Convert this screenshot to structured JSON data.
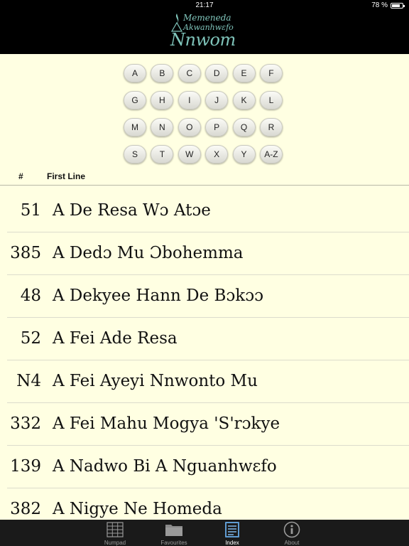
{
  "status": {
    "time": "21:17",
    "battery": "78 %"
  },
  "logo": {
    "line1": "Memeneda",
    "line2": "Akwanhwɛfo",
    "line3": "Nnwom"
  },
  "letters": [
    [
      "A",
      "B",
      "C",
      "D",
      "E",
      "F"
    ],
    [
      "G",
      "H",
      "I",
      "J",
      "K",
      "L"
    ],
    [
      "M",
      "N",
      "O",
      "P",
      "Q",
      "R"
    ],
    [
      "S",
      "T",
      "W",
      "X",
      "Y",
      "A-Z"
    ]
  ],
  "columns": {
    "number": "#",
    "first_line": "First Line"
  },
  "hymns": [
    {
      "number": "51",
      "title": "A De Resa Wɔ Atɔe"
    },
    {
      "number": "385",
      "title": "A Dedɔ Mu Ɔbohemma"
    },
    {
      "number": "48",
      "title": "A Dekyee Hann De Bɔkɔɔ"
    },
    {
      "number": "52",
      "title": "A Fei Ade Resa"
    },
    {
      "number": "N4",
      "title": "A Fei Ayeyi Nnwonto Mu"
    },
    {
      "number": "332",
      "title": "A Fei Mahu Mogya 'S'rɔkye"
    },
    {
      "number": "139",
      "title": "A Nadwo Bi A Nguanhwɛfo"
    },
    {
      "number": "382",
      "title": "A Nigye Ne Homeda"
    }
  ],
  "tabs": [
    {
      "label": "Numpad",
      "icon": "numpad-icon",
      "active": false
    },
    {
      "label": "Favourites",
      "icon": "folder-icon",
      "active": false
    },
    {
      "label": "Index",
      "icon": "book-icon",
      "active": true
    },
    {
      "label": "About",
      "icon": "info-icon",
      "active": false
    }
  ],
  "colors": {
    "background": "#FFFFE2",
    "header": "#000000",
    "logo": "#7FC4BA",
    "tab_bar": "#1A1A1A",
    "tab_active": "#7EB6E8"
  }
}
